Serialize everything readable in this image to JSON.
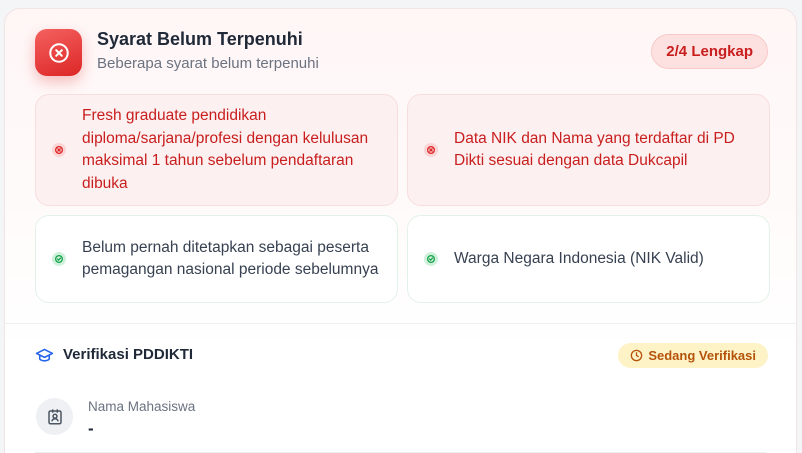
{
  "header": {
    "title": "Syarat Belum Terpenuhi",
    "subtitle": "Beberapa syarat belum terpenuhi",
    "progress": "2/4 Lengkap",
    "status_color": "#dc2626"
  },
  "requirements": [
    {
      "text": "Fresh graduate pendidikan diploma/sarjana/profesi dengan kelulusan maksimal 1 tahun sebelum pendaftaran dibuka",
      "status": "fail"
    },
    {
      "text": "Data NIK dan Nama yang terdaftar di PD Dikti sesuai dengan data Dukcapil",
      "status": "fail"
    },
    {
      "text": "Belum pernah ditetapkan sebagai peserta pemagangan nasional periode sebelumnya",
      "status": "ok"
    },
    {
      "text": "Warga Negara Indonesia (NIK Valid)",
      "status": "ok"
    }
  ],
  "verification": {
    "title": "Verifikasi PDDIKTI",
    "status": "Sedang Verifikasi",
    "fields": [
      {
        "label": "Nama Mahasiswa",
        "value": "-"
      }
    ]
  },
  "icons": {
    "header": "x-circle-icon",
    "fail": "x-circle-icon",
    "ok": "check-circle-icon",
    "section": "graduation-cap-icon",
    "status": "clock-icon",
    "field": "id-card-icon"
  },
  "colors": {
    "fail": "#c81e1e",
    "ok": "#16a34a",
    "pending": "#b45309",
    "accent": "#2563eb"
  }
}
